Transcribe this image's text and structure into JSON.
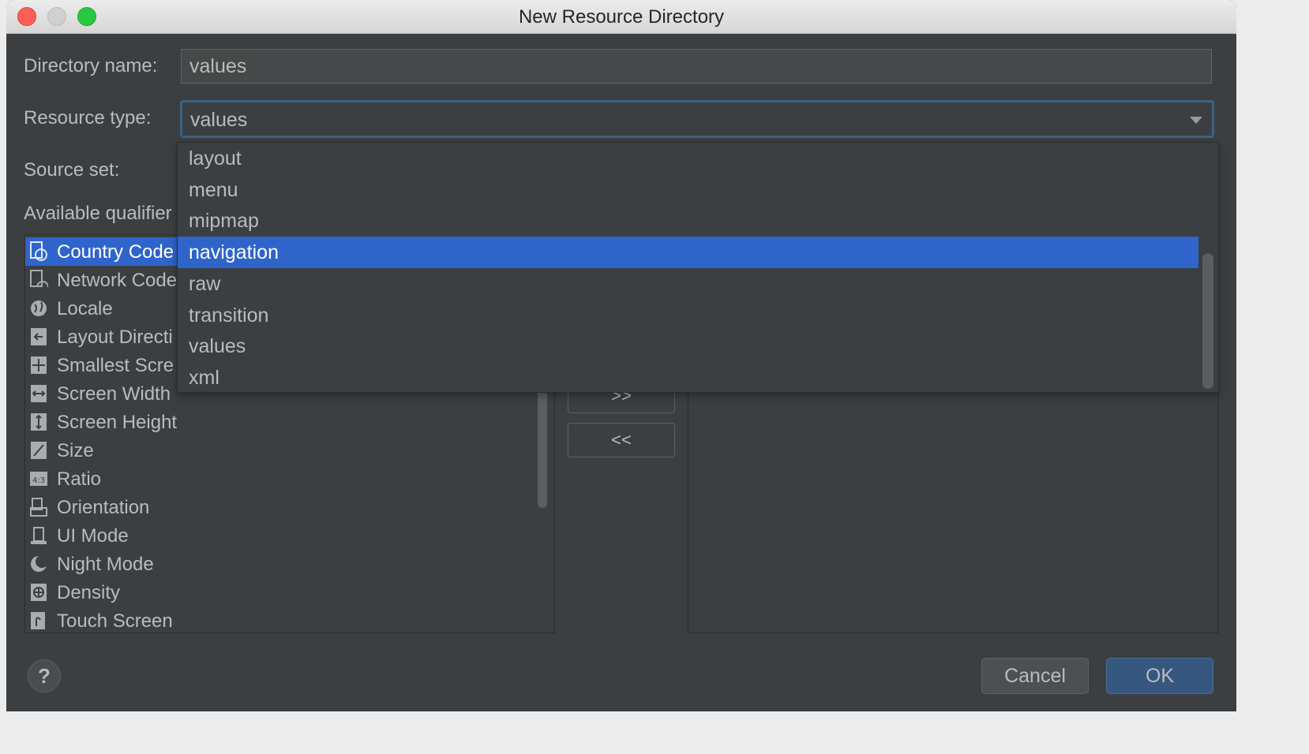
{
  "window": {
    "title": "New Resource Directory",
    "buttons": [
      "close",
      "minimize",
      "zoom"
    ]
  },
  "form": {
    "directory_name_label": "Directory name:",
    "directory_name_value": "values",
    "resource_type_label": "Resource type:",
    "resource_type_value": "values",
    "source_set_label": "Source set:",
    "available_qualifiers_label": "Available qualifier"
  },
  "qualifiers": [
    {
      "label": "Country Code",
      "icon": "country-code-icon",
      "selected": true
    },
    {
      "label": "Network Code",
      "icon": "network-code-icon",
      "selected": false
    },
    {
      "label": "Locale",
      "icon": "globe-icon",
      "selected": false
    },
    {
      "label": "Layout Directi",
      "icon": "layout-direction-icon",
      "selected": false
    },
    {
      "label": "Smallest Scre",
      "icon": "smallest-screen-icon",
      "selected": false
    },
    {
      "label": "Screen Width",
      "icon": "screen-width-icon",
      "selected": false
    },
    {
      "label": "Screen Height",
      "icon": "screen-height-icon",
      "selected": false
    },
    {
      "label": "Size",
      "icon": "size-icon",
      "selected": false
    },
    {
      "label": "Ratio",
      "icon": "ratio-icon",
      "selected": false
    },
    {
      "label": "Orientation",
      "icon": "orientation-icon",
      "selected": false
    },
    {
      "label": "UI Mode",
      "icon": "ui-mode-icon",
      "selected": false
    },
    {
      "label": "Night Mode",
      "icon": "night-mode-icon",
      "selected": false
    },
    {
      "label": "Density",
      "icon": "density-icon",
      "selected": false
    },
    {
      "label": "Touch Screen",
      "icon": "touch-screen-icon",
      "selected": false
    }
  ],
  "move_buttons": {
    "add": ">>",
    "remove": "<<"
  },
  "dropdown": {
    "options": [
      "layout",
      "menu",
      "mipmap",
      "navigation",
      "raw",
      "transition",
      "values",
      "xml"
    ],
    "highlighted": "navigation"
  },
  "footer": {
    "help": "?",
    "cancel": "Cancel",
    "ok": "OK"
  },
  "colors": {
    "dialog_bg": "#3c3f41",
    "selection": "#2f65ca",
    "ok_button": "#365880",
    "focus_border": "#3d6185"
  }
}
